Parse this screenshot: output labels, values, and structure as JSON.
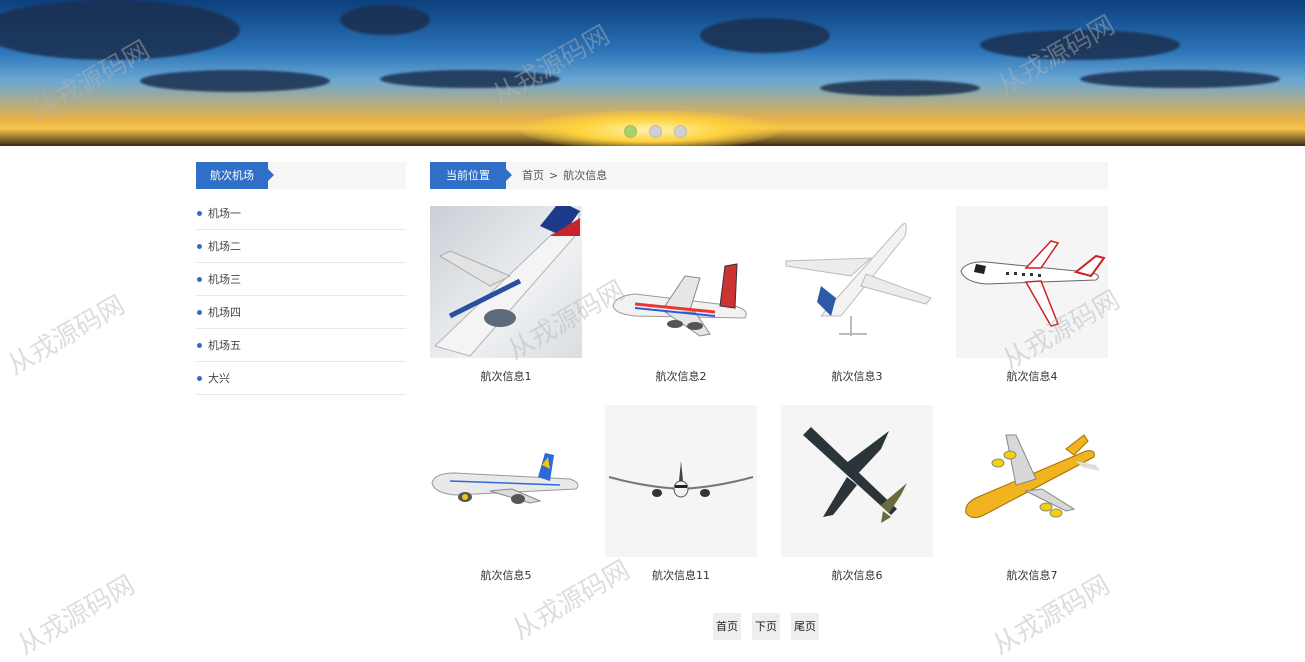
{
  "banner": {
    "dots": 3,
    "active_dot": 0
  },
  "sidebar": {
    "title": "航次机场",
    "items": [
      {
        "label": "机场一"
      },
      {
        "label": "机场二"
      },
      {
        "label": "机场三"
      },
      {
        "label": "机场四"
      },
      {
        "label": "机场五"
      },
      {
        "label": "大兴"
      }
    ]
  },
  "breadcrumb": {
    "title": "当前位置",
    "home": "首页",
    "separator": ">",
    "current": "航次信息"
  },
  "cards": [
    {
      "caption": "航次信息1"
    },
    {
      "caption": "航次信息2"
    },
    {
      "caption": "航次信息3"
    },
    {
      "caption": "航次信息4"
    },
    {
      "caption": "航次信息5"
    },
    {
      "caption": "航次信息11"
    },
    {
      "caption": "航次信息6"
    },
    {
      "caption": "航次信息7"
    }
  ],
  "pager": {
    "first": "首页",
    "next": "下页",
    "last": "尾页"
  },
  "watermark": "从戎源码网",
  "colors": {
    "accent": "#2f6fc7",
    "active_dot": "#a8cf6a"
  }
}
